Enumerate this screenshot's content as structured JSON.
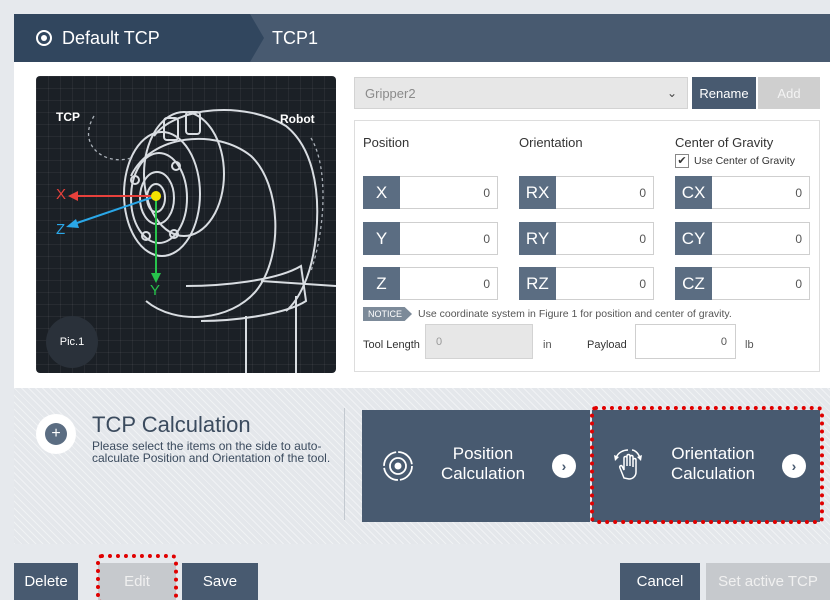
{
  "tabs": [
    {
      "label": "Default TCP",
      "active": true
    },
    {
      "label": "TCP1",
      "active": false
    }
  ],
  "picture": {
    "labels": {
      "tcp": "TCP",
      "robot": "Robot",
      "x": "X",
      "y": "Y",
      "z": "Z"
    },
    "badge": "Pic.1"
  },
  "gripper": {
    "selected": "Gripper2",
    "rename_label": "Rename",
    "add_label": "Add"
  },
  "form": {
    "position_title": "Position",
    "orientation_title": "Orientation",
    "cog_title": "Center of Gravity",
    "use_cog_label": "Use Center of Gravity",
    "use_cog_checked": true,
    "position": [
      {
        "label": "X",
        "value": "0"
      },
      {
        "label": "Y",
        "value": "0"
      },
      {
        "label": "Z",
        "value": "0"
      }
    ],
    "orientation": [
      {
        "label": "RX",
        "value": "0"
      },
      {
        "label": "RY",
        "value": "0"
      },
      {
        "label": "RZ",
        "value": "0"
      }
    ],
    "cog": [
      {
        "label": "CX",
        "value": "0"
      },
      {
        "label": "CY",
        "value": "0"
      },
      {
        "label": "CZ",
        "value": "0"
      }
    ],
    "notice_tag": "NOTICE",
    "notice_text": "Use coordinate system in Figure 1 for position and center of gravity.",
    "tool_length_label": "Tool Length",
    "tool_length_value": "0",
    "tool_length_unit": "in",
    "payload_label": "Payload",
    "payload_value": "0",
    "payload_unit": "lb"
  },
  "calc": {
    "title": "TCP Calculation",
    "description": "Please select the items on the side to auto-calculate Position and Orientation of the tool.",
    "position_line1": "Position",
    "position_line2": "Calculation",
    "orientation_line1": "Orientation",
    "orientation_line2": "Calculation"
  },
  "buttons": {
    "delete": "Delete",
    "edit": "Edit",
    "save": "Save",
    "cancel": "Cancel",
    "set_active": "Set active TCP"
  },
  "colors": {
    "primary": "#485a70",
    "tab_active": "#31465e",
    "label_bg": "#5b6d82",
    "disabled": "#cfcfcf",
    "highlight": "#e00000",
    "axis_x": "#e8413c",
    "axis_y": "#27c24c",
    "axis_z": "#2aa7e8",
    "tcp_point": "#f5e300"
  }
}
